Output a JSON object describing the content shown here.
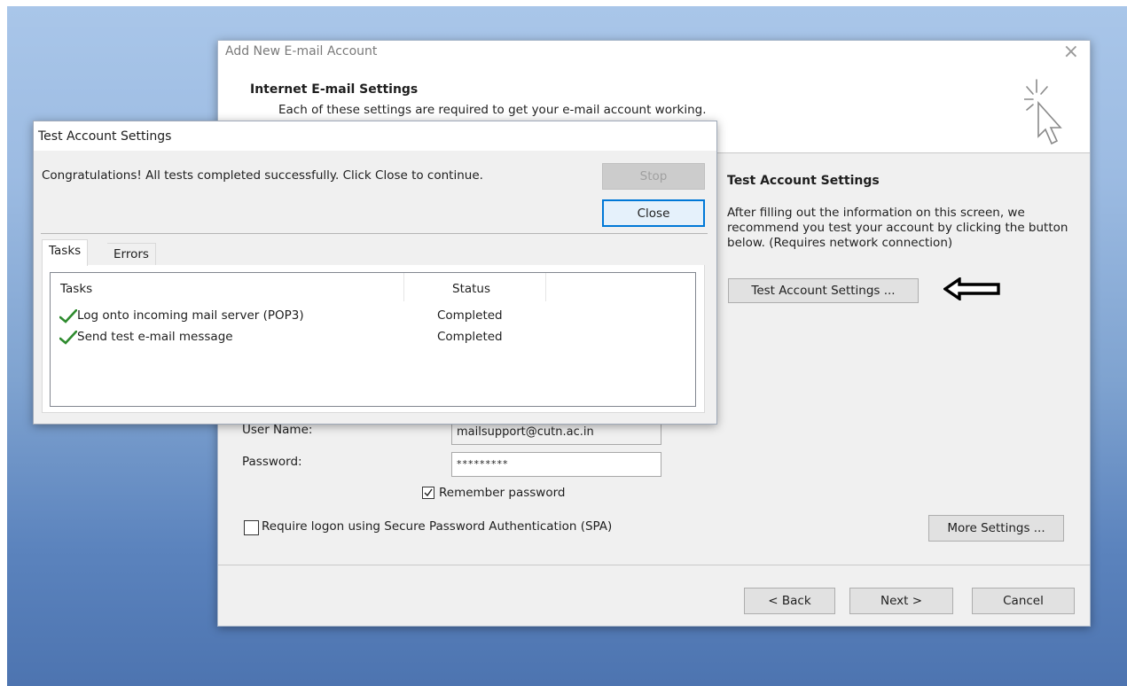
{
  "main_dialog": {
    "title": "Add New E-mail Account",
    "header_title": "Internet E-mail Settings",
    "header_subtitle": "Each of these settings are required to get your e-mail account working.",
    "test_section_title": "Test Account Settings",
    "test_section_desc": "After filling out the information on this screen, we recommend you test your account by clicking the button below. (Requires network connection)",
    "test_button_label": "Test Account Settings ...",
    "username_label": "User Name:",
    "username_value": "mailsupport@cutn.ac.in",
    "password_label": "Password:",
    "password_value": "*********",
    "remember_password_label": "Remember password",
    "remember_password_checked": true,
    "spa_label": "Require logon using Secure Password Authentication (SPA)",
    "spa_checked": false,
    "more_settings_label": "More Settings ...",
    "back_label": "< Back",
    "next_label": "Next >",
    "cancel_label": "Cancel"
  },
  "test_dialog": {
    "title": "Test Account Settings",
    "message": "Congratulations! All tests completed successfully. Click Close to continue.",
    "stop_label": "Stop",
    "close_label": "Close",
    "tabs": [
      "Tasks",
      "Errors"
    ],
    "columns": [
      "Tasks",
      "Status"
    ],
    "rows": [
      {
        "task": "Log onto incoming mail server (POP3)",
        "status": "Completed"
      },
      {
        "task": "Send test e-mail message",
        "status": "Completed"
      }
    ]
  },
  "icons": {
    "close": "close-icon",
    "wizard_cursor": "cursor-click-icon",
    "annotation_arrow": "left-arrow-icon",
    "check": "check-icon"
  },
  "colors": {
    "check_green": "#2e8b2e",
    "focus_border": "#0078d7"
  }
}
